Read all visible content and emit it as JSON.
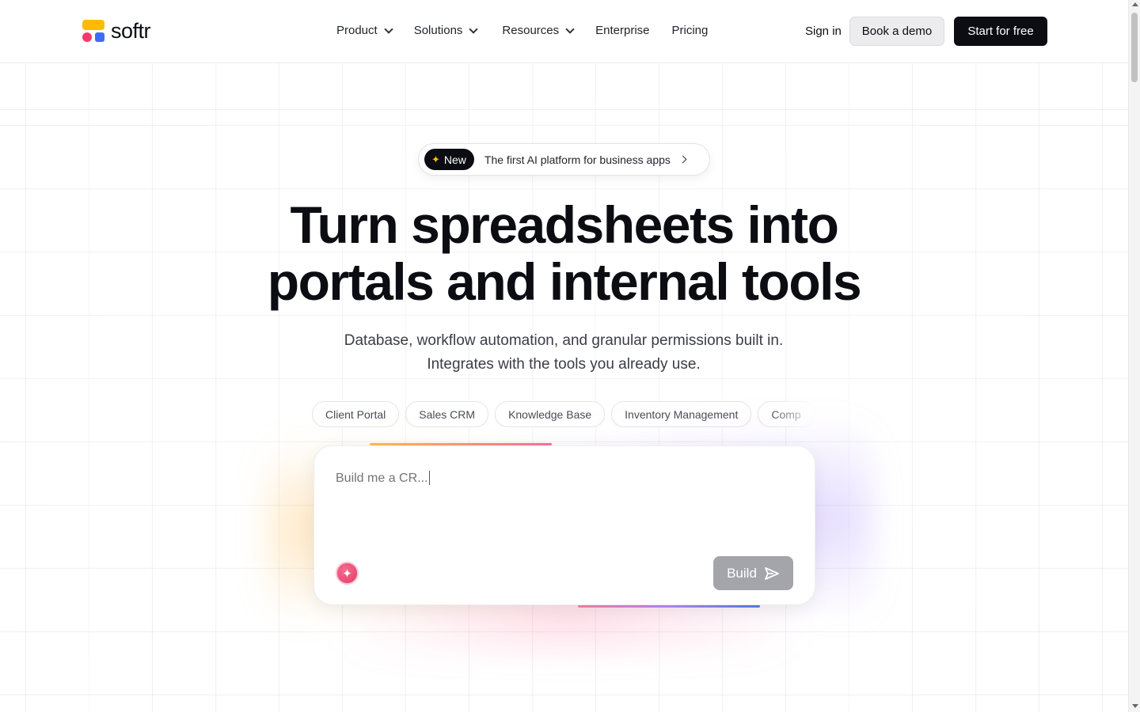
{
  "header": {
    "logo_text": "softr",
    "nav": [
      {
        "label": "Product",
        "has_dropdown": true
      },
      {
        "label": "Solutions",
        "has_dropdown": true
      },
      {
        "label": "Resources",
        "has_dropdown": true
      },
      {
        "label": "Enterprise",
        "has_dropdown": false
      },
      {
        "label": "Pricing",
        "has_dropdown": false
      }
    ],
    "sign_in": "Sign in",
    "book_demo": "Book a demo",
    "start_free": "Start for free"
  },
  "announcement": {
    "badge": "New",
    "badge_icon": "sparkle-icon",
    "text": "The first AI platform for business apps",
    "arrow_icon": "chevron-right-icon"
  },
  "hero": {
    "title_line1": "Turn spreadsheets into",
    "title_line2": "portals and internal tools",
    "subtitle": "Database, workflow automation, and granular permissions built in. Integrates with the tools you already use."
  },
  "tags": [
    "Client Portal",
    "Sales CRM",
    "Knowledge Base",
    "Inventory Management",
    "Comp"
  ],
  "prompt": {
    "value": "Build me a CR...",
    "ai_icon": "ai-sparkle-icon",
    "build_label": "Build",
    "send_icon": "send-icon"
  },
  "colors": {
    "logo_yellow": "#ffbb00",
    "logo_pink": "#f33a6a",
    "logo_blue": "#3c6ef5",
    "primary_dark": "#0b0d12",
    "build_disabled": "#a4a5aa"
  }
}
